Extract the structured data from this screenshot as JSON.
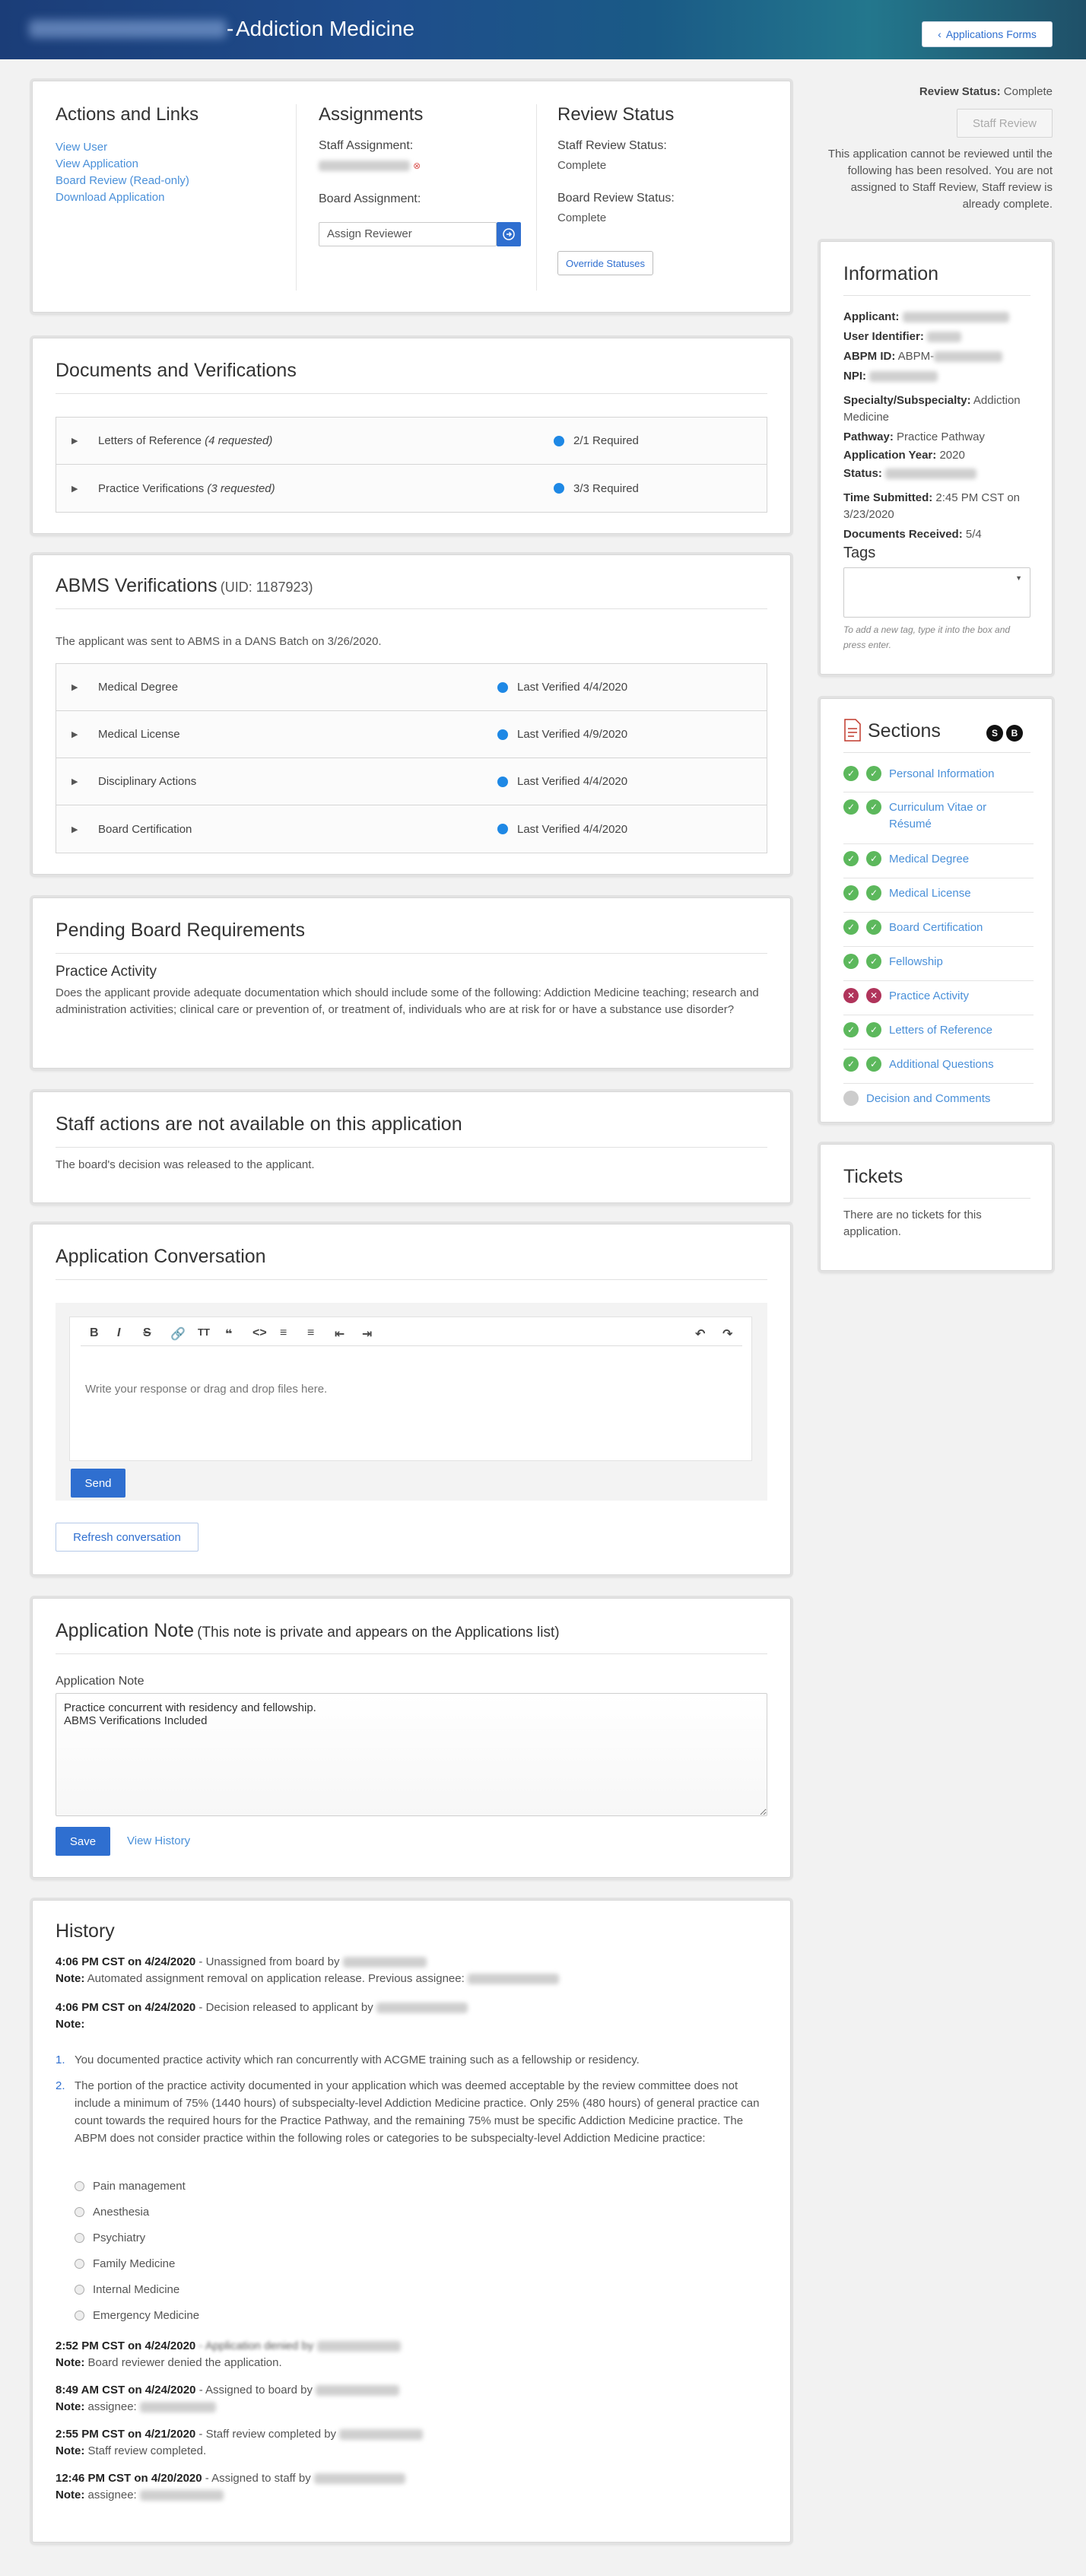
{
  "header": {
    "separator": "-",
    "title": "Addiction Medicine",
    "forms_button": "Applications Forms"
  },
  "actions": {
    "title": "Actions and Links",
    "links": [
      "View User",
      "View Application",
      "Board Review (Read-only)",
      "Download Application"
    ]
  },
  "assignments": {
    "title": "Assignments",
    "staff_label": "Staff Assignment:",
    "board_label": "Board Assignment:",
    "board_select_value": "Assign Reviewer"
  },
  "review_status": {
    "title": "Review Status",
    "staff_label": "Staff Review Status:",
    "staff_value": "Complete",
    "board_label": "Board Review Status:",
    "board_value": "Complete",
    "override_button": "Override Statuses"
  },
  "documents": {
    "title": "Documents and Verifications",
    "rows": [
      {
        "name": "Letters of Reference",
        "note": "(4 requested)",
        "status": "2/1 Required"
      },
      {
        "name": "Practice Verifications",
        "note": "(3 requested)",
        "status": "3/3 Required"
      }
    ]
  },
  "abms": {
    "title": "ABMS Verifications",
    "uid": "(UID: 1187923)",
    "intro": "The applicant was sent to ABMS in a DANS Batch on 3/26/2020.",
    "rows": [
      {
        "name": "Medical Degree",
        "status": "Last Verified 4/4/2020"
      },
      {
        "name": "Medical License",
        "status": "Last Verified 4/9/2020"
      },
      {
        "name": "Disciplinary Actions",
        "status": "Last Verified 4/4/2020"
      },
      {
        "name": "Board Certification",
        "status": "Last Verified 4/4/2020"
      }
    ]
  },
  "pending": {
    "title": "Pending Board Requirements",
    "subtitle": "Practice Activity",
    "text": "Does the applicant provide adequate documentation which should include some of the following: Addiction Medicine teaching; research and administration activities; clinical care or prevention of, or treatment of, individuals who are at risk for or have a substance use disorder?"
  },
  "staff_actions": {
    "title": "Staff actions are not available on this application",
    "text": "The board's decision was released to the applicant."
  },
  "conversation": {
    "title": "Application Conversation",
    "placeholder": "Write your response or drag and drop files here.",
    "send_button": "Send",
    "refresh_button": "Refresh conversation"
  },
  "note": {
    "title": "Application Note",
    "subtitle": "(This note is private and appears on the Applications list)",
    "label": "Application Note",
    "value": "Practice concurrent with residency and fellowship.\nABMS Verifications Included",
    "save_button": "Save",
    "history_link": "View History"
  },
  "history": {
    "title": "History",
    "entries": [
      {
        "time": "4:06 PM CST on 4/24/2020",
        "action": " - Unassigned from board by",
        "note_label": "Note:",
        "note": " Automated assignment removal on application release. Previous assignee:"
      },
      {
        "time": "4:06 PM CST on 4/24/2020",
        "action": " - Decision released to applicant by",
        "note_label": "Note:",
        "note": ""
      }
    ],
    "numbered": [
      "You documented practice activity which ran concurrently with ACGME training such as a fellowship or residency.",
      "The portion of the practice activity documented in your application which was deemed acceptable by the review committee does not include a minimum of 75% (1440 hours) of subspecialty-level Addiction Medicine practice. Only 25% (480 hours) of general practice can count towards the required hours for the Practice Pathway, and the remaining 75% must be specific Addiction Medicine practice. The ABPM does not consider practice within the following roles or categories to be subspecialty-level Addiction Medicine practice:"
    ],
    "bullets": [
      "Pain management",
      "Anesthesia",
      "Psychiatry",
      "Family Medicine",
      "Internal Medicine",
      "Emergency Medicine"
    ],
    "later": [
      {
        "time": "2:52 PM CST on 4/24/2020",
        "action": " - Application denied by",
        "note_label": "Note:",
        "note": " Board reviewer denied the application."
      },
      {
        "time": "8:49 AM CST on 4/24/2020",
        "action": " - Assigned to board by",
        "note_label": "Note:",
        "note": " assignee:"
      },
      {
        "time": "2:55 PM CST on 4/21/2020",
        "action": " - Staff review completed by",
        "note_label": "Note:",
        "note": " Staff review completed."
      },
      {
        "time": "12:46 PM CST on 4/20/2020",
        "action": " - Assigned to staff by",
        "note_label": "Note:",
        "note": " assignee:"
      }
    ]
  },
  "sidebar": {
    "review_status_label": "Review Status:",
    "review_status_value": "Complete",
    "staff_review_button": "Staff Review",
    "notice": "This application cannot be reviewed until the following has been resolved. You are not assigned to Staff Review, Staff review is already complete.",
    "info": {
      "title": "Information",
      "applicant_label": "Applicant:",
      "user_id_label": "User Identifier:",
      "abpm_label": "ABPM ID:",
      "abpm_prefix": "ABPM-",
      "npi_label": "NPI:",
      "specialty_label": "Specialty/Subspecialty:",
      "specialty_value": "Addiction Medicine",
      "pathway_label": "Pathway:",
      "pathway_value": "Practice Pathway",
      "year_label": "Application Year:",
      "year_value": "2020",
      "status_label": "Status:",
      "submitted_label": "Time Submitted:",
      "submitted_value": "2:45 PM CST on 3/23/2020",
      "docs_label": "Documents Received:",
      "docs_value": "5/4",
      "tags_title": "Tags",
      "tags_hint": "To add a new tag, type it into the box and press enter."
    },
    "sections": {
      "title": "Sections",
      "badge_s": "S",
      "badge_b": "B",
      "items": [
        {
          "label": "Personal Information",
          "s": "ok",
          "b": "ok"
        },
        {
          "label": "Curriculum Vitae or Résumé",
          "s": "ok",
          "b": "ok"
        },
        {
          "label": "Medical Degree",
          "s": "ok",
          "b": "ok"
        },
        {
          "label": "Medical License",
          "s": "ok",
          "b": "ok"
        },
        {
          "label": "Board Certification",
          "s": "ok",
          "b": "ok"
        },
        {
          "label": "Fellowship",
          "s": "ok",
          "b": "ok"
        },
        {
          "label": "Practice Activity",
          "s": "fail",
          "b": "fail"
        },
        {
          "label": "Letters of Reference",
          "s": "ok",
          "b": "ok"
        },
        {
          "label": "Additional Questions",
          "s": "ok",
          "b": "ok"
        },
        {
          "label": "Decision and Comments",
          "s": "none",
          "b": "none"
        }
      ]
    },
    "tickets": {
      "title": "Tickets",
      "text": "There are no tickets for this application."
    }
  }
}
